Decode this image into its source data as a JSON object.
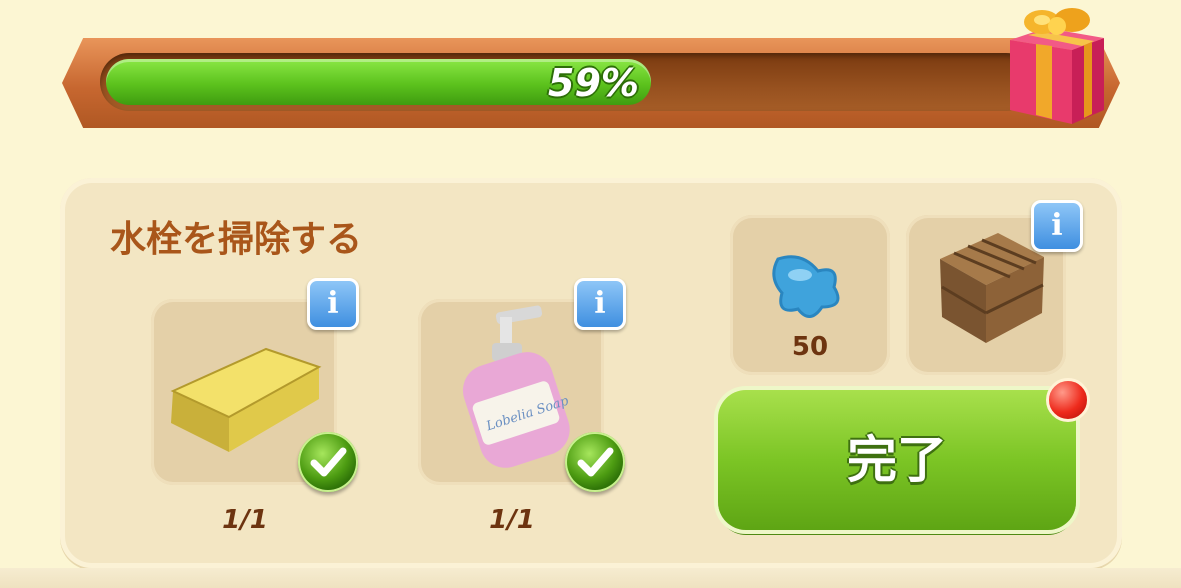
{
  "progress": {
    "percent_label": "59%",
    "value": 0.59
  },
  "task": {
    "title": "水栓を掃除する"
  },
  "items": [
    {
      "name": "sponge",
      "count": "1/1",
      "done": true
    },
    {
      "name": "soap",
      "count": "1/1",
      "done": true
    }
  ],
  "soap_label": "Lobelia Soap",
  "rewards": {
    "gem_amount": "50",
    "crate_icon": "wooden-crate-icon"
  },
  "buttons": {
    "info_label": "i",
    "complete_label": "完了"
  },
  "colors": {
    "accent_green": "#7cc525",
    "title_brown": "#a9561a",
    "bar_frame": "#c76730"
  }
}
